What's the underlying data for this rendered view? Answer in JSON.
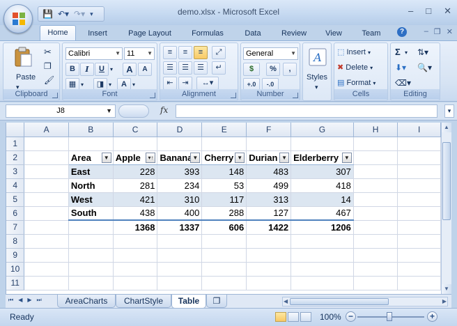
{
  "window": {
    "title": "demo.xlsx - Microsoft Excel"
  },
  "ribbon_tabs": [
    "Home",
    "Insert",
    "Page Layout",
    "Formulas",
    "Data",
    "Review",
    "View",
    "Team"
  ],
  "clipboard": {
    "paste": "Paste",
    "label": "Clipboard"
  },
  "font": {
    "name": "Calibri",
    "size": "11",
    "label": "Font",
    "bold": "B",
    "italic": "I",
    "underline": "U",
    "grow": "A",
    "shrink": "A",
    "color_letter": "A"
  },
  "alignment": {
    "label": "Alignment"
  },
  "number": {
    "format": "General",
    "label": "Number",
    "currency": "$",
    "percent": "%",
    "comma": ",",
    "inc": "+.0",
    "dec": "-.0"
  },
  "styles": {
    "label": "Styles"
  },
  "cells": {
    "insert": "Insert",
    "delete": "Delete",
    "format": "Format",
    "label": "Cells"
  },
  "editing": {
    "label": "Editing",
    "sum": "Σ"
  },
  "formula_bar": {
    "name_box": "J8",
    "fx": "fx",
    "value": ""
  },
  "columns": [
    "A",
    "B",
    "C",
    "D",
    "E",
    "F",
    "G",
    "H",
    "I"
  ],
  "rows": [
    "1",
    "2",
    "3",
    "4",
    "5",
    "6",
    "7",
    "8",
    "9",
    "10",
    "11"
  ],
  "table": {
    "headers": [
      "Area",
      "Apple",
      "Banana",
      "Cherry",
      "Durian",
      "Elderberry"
    ],
    "data": [
      [
        "East",
        "228",
        "393",
        "148",
        "483",
        "307"
      ],
      [
        "North",
        "281",
        "234",
        "53",
        "499",
        "418"
      ],
      [
        "West",
        "421",
        "310",
        "117",
        "313",
        "14"
      ],
      [
        "South",
        "438",
        "400",
        "288",
        "127",
        "467"
      ]
    ],
    "totals": [
      "1368",
      "1337",
      "606",
      "1422",
      "1206"
    ]
  },
  "sheets": [
    "AreaCharts",
    "ChartStyle",
    "Table"
  ],
  "active_sheet": "Table",
  "status": {
    "text": "Ready",
    "zoom": "100%"
  },
  "colors": {
    "table_band": "#dce6f1",
    "table_accent": "#4f81bd",
    "ribbon": "#d6e3f3"
  }
}
